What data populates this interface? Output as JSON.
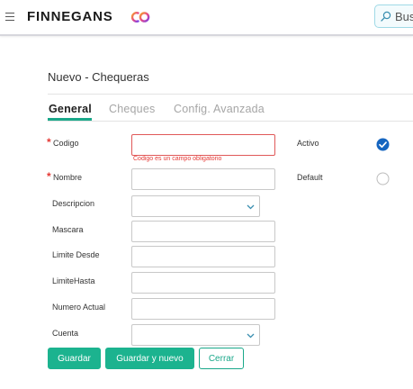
{
  "header": {
    "brand": "FINNEGANS",
    "search_text": "Bus"
  },
  "page": {
    "title": "Nuevo - Chequeras"
  },
  "tabs": [
    {
      "label": "General",
      "active": true
    },
    {
      "label": "Cheques",
      "active": false
    },
    {
      "label": "Config. Avanzada",
      "active": false
    }
  ],
  "form": {
    "required_mark": "*",
    "codigo": {
      "label": "Codigo",
      "value": "",
      "error": "Codigo es un campo obligatorio"
    },
    "nombre": {
      "label": "Nombre",
      "value": ""
    },
    "descripcion": {
      "label": "Descripcion",
      "value": ""
    },
    "mascara": {
      "label": "Mascara",
      "value": ""
    },
    "limite_desde": {
      "label": "Limite Desde",
      "value": ""
    },
    "limite_hasta": {
      "label": "LimiteHasta",
      "value": ""
    },
    "numero_actual": {
      "label": "Numero Actual",
      "value": ""
    },
    "cuenta": {
      "label": "Cuenta",
      "value": ""
    },
    "activo": {
      "label": "Activo",
      "checked": true
    },
    "default": {
      "label": "Default",
      "checked": false
    }
  },
  "buttons": {
    "save": "Guardar",
    "save_new": "Guardar y nuevo",
    "cancel": "Cerrar"
  },
  "colors": {
    "accent": "#1cb38f",
    "error": "#e53935",
    "check": "#1565c0"
  },
  "icons": {
    "menu": "hamburger-icon",
    "logo": "co-logo-icon",
    "search": "search-icon",
    "dropdown": "chevron-down-icon",
    "checkbox_on": "checkbox-checked-icon",
    "checkbox_off": "checkbox-empty-icon"
  }
}
